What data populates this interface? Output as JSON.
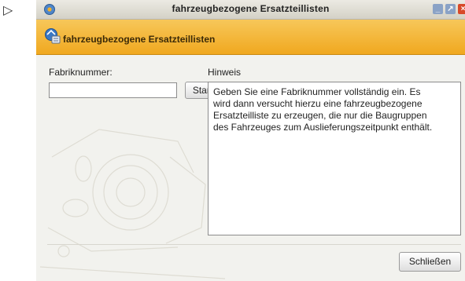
{
  "window": {
    "title": "fahrzeugbezogene Ersatzteillisten",
    "controls": {
      "minimize_label": "_",
      "maximize_label": "↗",
      "close_label": "×"
    }
  },
  "header": {
    "title": "fahrzeugbezogene Ersatzteillisten"
  },
  "form": {
    "fabriknummer_label": "Fabriknummer:",
    "fabriknummer_value": "",
    "start_label": "Start"
  },
  "hint": {
    "label": "Hinweis",
    "text": "Geben Sie eine Fabriknummer vollständig ein. Es\nwird dann versucht hierzu eine fahrzeugbezogene\nErsatzteilliste zu erzeugen, die nur die Baugruppen\ndes Fahrzeuges zum Auslieferungszeitpunkt enthält."
  },
  "footer": {
    "close_label": "Schließen"
  },
  "icons": {
    "arrow": "play-outline-icon",
    "title": "app-icon",
    "header": "parts-list-icon"
  },
  "colors": {
    "header_orange": "#f0a81f",
    "close_red": "#d84a2a",
    "window_bg": "#f2f2ee"
  }
}
